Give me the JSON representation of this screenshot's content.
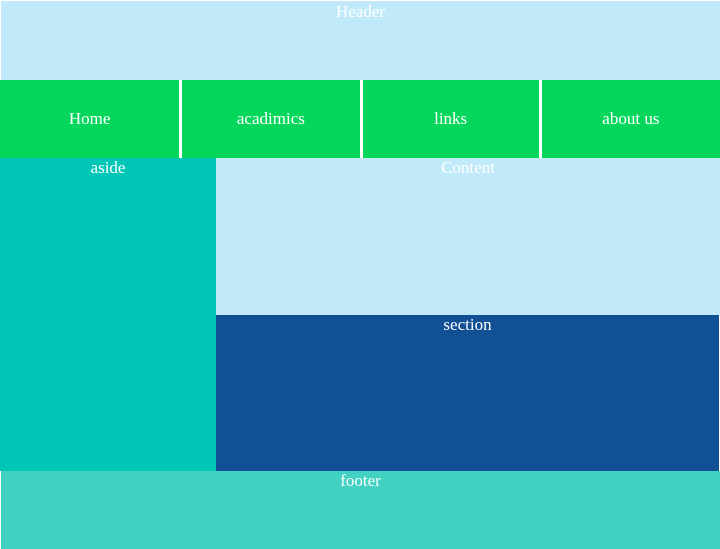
{
  "header": {
    "label": "Header"
  },
  "nav": {
    "items": [
      {
        "label": "Home"
      },
      {
        "label": "acadimics"
      },
      {
        "label": "links"
      },
      {
        "label": "about us"
      }
    ]
  },
  "aside": {
    "label": "aside"
  },
  "content": {
    "label": "Content"
  },
  "section": {
    "label": "section"
  },
  "footer": {
    "label": "footer"
  },
  "colors": {
    "header": "#c0eafa",
    "nav": "#05d75c",
    "aside": "#00c6b6",
    "content": "#c0eafa",
    "section": "#115094",
    "footer": "#42d1c2"
  }
}
